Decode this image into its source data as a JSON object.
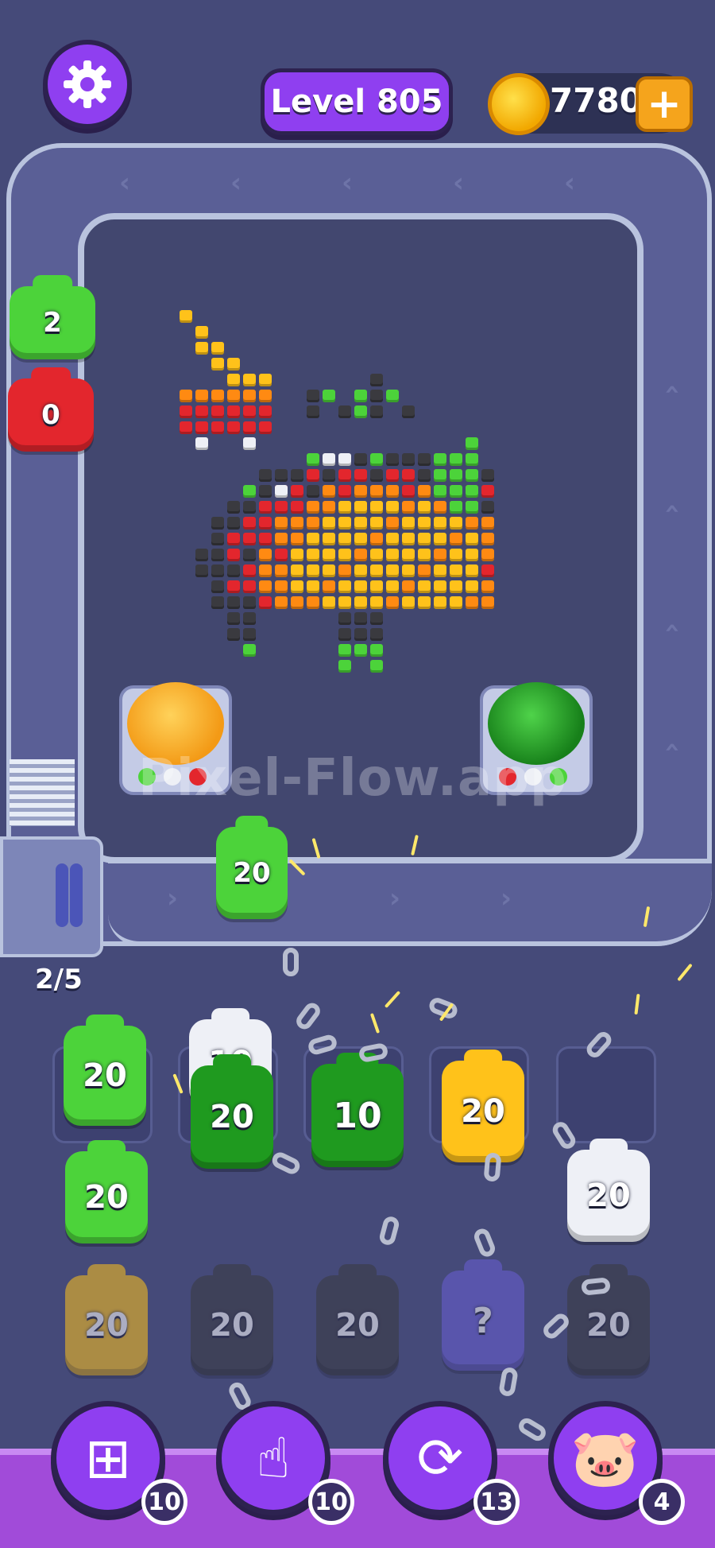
{
  "header": {
    "settings_icon": "gear-icon",
    "level_label": "Level 805",
    "coins": "7780",
    "coin_icon": "coin-icon",
    "add_coins_icon": "plus-icon"
  },
  "conveyor": {
    "capacity_label": "2/5",
    "shooters_on_belt": [
      {
        "color": "green",
        "count": "2"
      },
      {
        "color": "red",
        "count": "0"
      },
      {
        "color": "green",
        "count": "20"
      }
    ]
  },
  "bosses": [
    {
      "name": "pumpkin-pig",
      "color": "#f6a21a"
    },
    {
      "name": "green-pig",
      "color": "#2fa52c"
    }
  ],
  "watermark": "Pixel-Flow.app",
  "queue": {
    "rows": [
      [
        {
          "color": "green",
          "count": "20"
        },
        {
          "color": "white",
          "count": "10"
        },
        {
          "color": "darkgreen",
          "count": "20"
        },
        {
          "color": "darkgreen",
          "count": "10"
        },
        {
          "color": "yellow",
          "count": "20"
        },
        {
          "color": "empty",
          "count": ""
        }
      ],
      [
        {
          "color": "green",
          "count": "20"
        },
        {
          "color": "white",
          "count": "20"
        }
      ],
      [
        {
          "color": "yellow",
          "count": "20",
          "dim": true
        },
        {
          "color": "black",
          "count": "20",
          "dim": true
        },
        {
          "color": "black",
          "count": "20",
          "dim": true
        },
        {
          "color": "purple",
          "count": "?",
          "dim": true
        },
        {
          "color": "black",
          "count": "20",
          "dim": true
        }
      ]
    ]
  },
  "toolbar": {
    "tools": [
      {
        "icon": "add-slot-icon",
        "count": "10"
      },
      {
        "icon": "hand-pointer-icon",
        "count": "10"
      },
      {
        "icon": "shuffle-icon",
        "count": "13"
      },
      {
        "icon": "magnet-pig-icon",
        "count": "4"
      }
    ]
  },
  "colors": {
    "green": "#4cd33a",
    "darkgreen": "#1f9a1f",
    "yellow": "#ffc21a",
    "white": "#eef0f6",
    "black": "#3a3a3f",
    "red": "#e3262d",
    "orange": "#ff8a12",
    "purple": "#6a5fd6"
  }
}
